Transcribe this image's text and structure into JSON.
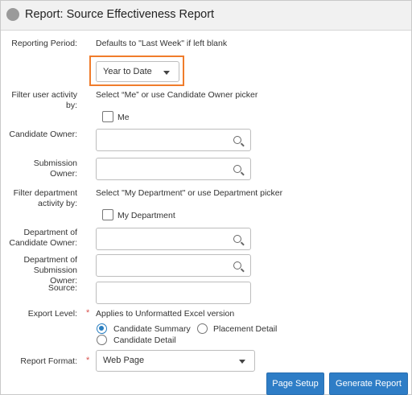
{
  "header": {
    "title": "Report: Source Effectiveness Report"
  },
  "form": {
    "reporting_period": {
      "label": "Reporting Period:",
      "hint": "Defaults to \"Last Week\" if left blank",
      "selected": "Year to Date"
    },
    "filter_user": {
      "label_line1": "Filter user activity",
      "label_line2": "by:",
      "hint": "Select “Me” or use Candidate Owner picker",
      "checkbox_label": "Me"
    },
    "candidate_owner": {
      "label": "Candidate Owner:"
    },
    "submission_owner": {
      "label": "Submission Owner:"
    },
    "filter_department": {
      "label_line1": "Filter department",
      "label_line2": "activity by:",
      "hint": "Select \"My Department\" or use Department picker",
      "checkbox_label": "My Department"
    },
    "department_candidate_owner": {
      "label_line1": "Department of",
      "label_line2": "Candidate Owner:"
    },
    "department_submission_owner": {
      "label_line1": "Department of",
      "label_line2": "Submission Owner:"
    },
    "source": {
      "label": "Source:"
    },
    "export_level": {
      "label": "Export Level:",
      "required_mark": "*",
      "hint": "Applies to Unformatted Excel version",
      "options": [
        "Candidate Summary",
        "Placement Detail",
        "Candidate Detail"
      ],
      "selected": "Candidate Summary"
    },
    "report_format": {
      "label": "Report Format:",
      "required_mark": "*",
      "selected": "Web Page"
    }
  },
  "buttons": {
    "page_setup": "Page Setup",
    "generate_report": "Generate Report"
  },
  "colors": {
    "accent": "#2e7dc6",
    "highlight": "#f07c2b",
    "required": "#d9534f"
  }
}
